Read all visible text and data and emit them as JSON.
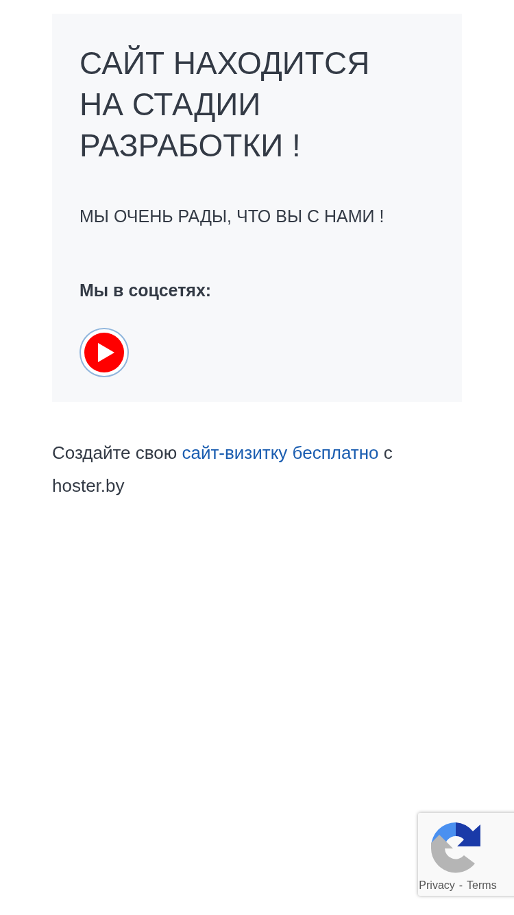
{
  "card": {
    "title": "САЙТ НАХОДИТСЯ НА СТАДИИ РАЗРАБОТКИ !",
    "subtitle": "МЫ ОЧЕНЬ РАДЫ, ЧТО ВЫ С НАМИ !",
    "social_heading": "Мы в соцсетях:"
  },
  "footer": {
    "before": "Создайте свою ",
    "link": "сайт-визитку бесплатно",
    "after": " с hoster.by"
  },
  "recaptcha": {
    "privacy": "Privacy",
    "separator": "-",
    "terms": "Terms"
  }
}
